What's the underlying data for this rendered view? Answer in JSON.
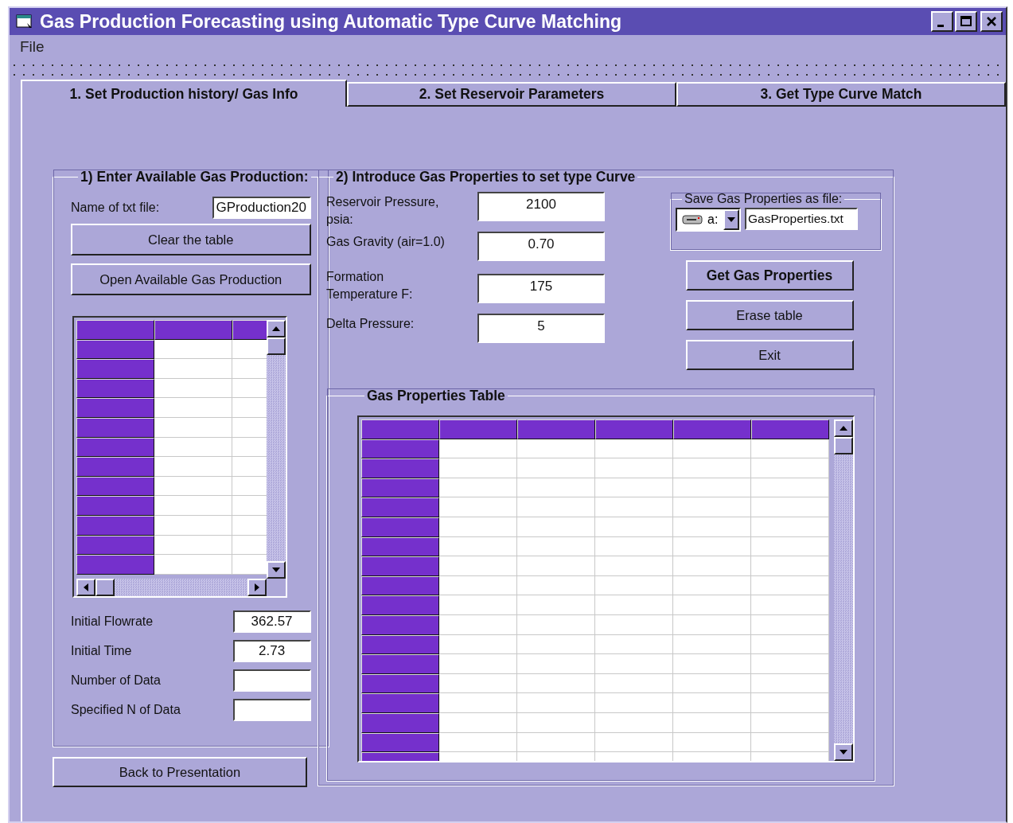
{
  "window": {
    "title": "Gas Production Forecasting using Automatic Type Curve Matching"
  },
  "menu": [
    "File"
  ],
  "tabs": [
    {
      "label": "1. Set Production history/ Gas Info",
      "selected": true
    },
    {
      "label": "2.  Set Reservoir Parameters",
      "selected": false
    },
    {
      "label": "3.  Get Type Curve Match",
      "selected": false
    }
  ],
  "production_group": {
    "title": "1) Enter Available Gas Production:",
    "file_label": "Name of txt file:",
    "file_value": "GProduction20",
    "buttons": [
      "Clear the table",
      "Open Available Gas Production"
    ],
    "fields": [
      {
        "label": "Initial Flowrate",
        "value": "362.57"
      },
      {
        "label": "Initial Time",
        "value": "2.73"
      },
      {
        "label": "Number of Data"
      },
      {
        "label": "Specified N of Data"
      }
    ]
  },
  "back_button": "Back to Presentation",
  "gas_group": {
    "title": "2) Introduce Gas Properties to set type Curve",
    "fields": [
      {
        "label": "Reservoir Pressure, psia:",
        "value": "2100"
      },
      {
        "label": "Gas Gravity (air=1.0)",
        "value": "0.70"
      },
      {
        "label": "Formation Temperature F:",
        "value": "175"
      },
      {
        "label": "Delta Pressure:",
        "value": "5"
      }
    ],
    "save": {
      "title": "Save Gas Properties  as file:",
      "drive": "a:",
      "file": "GasProperties.txt"
    },
    "buttons": [
      {
        "label": "Get Gas Properties",
        "kind": "default"
      },
      {
        "label": "Erase table",
        "kind": "normal"
      },
      {
        "label": "Exit",
        "kind": "normal"
      }
    ],
    "table_title": "Gas Properties Table"
  }
}
